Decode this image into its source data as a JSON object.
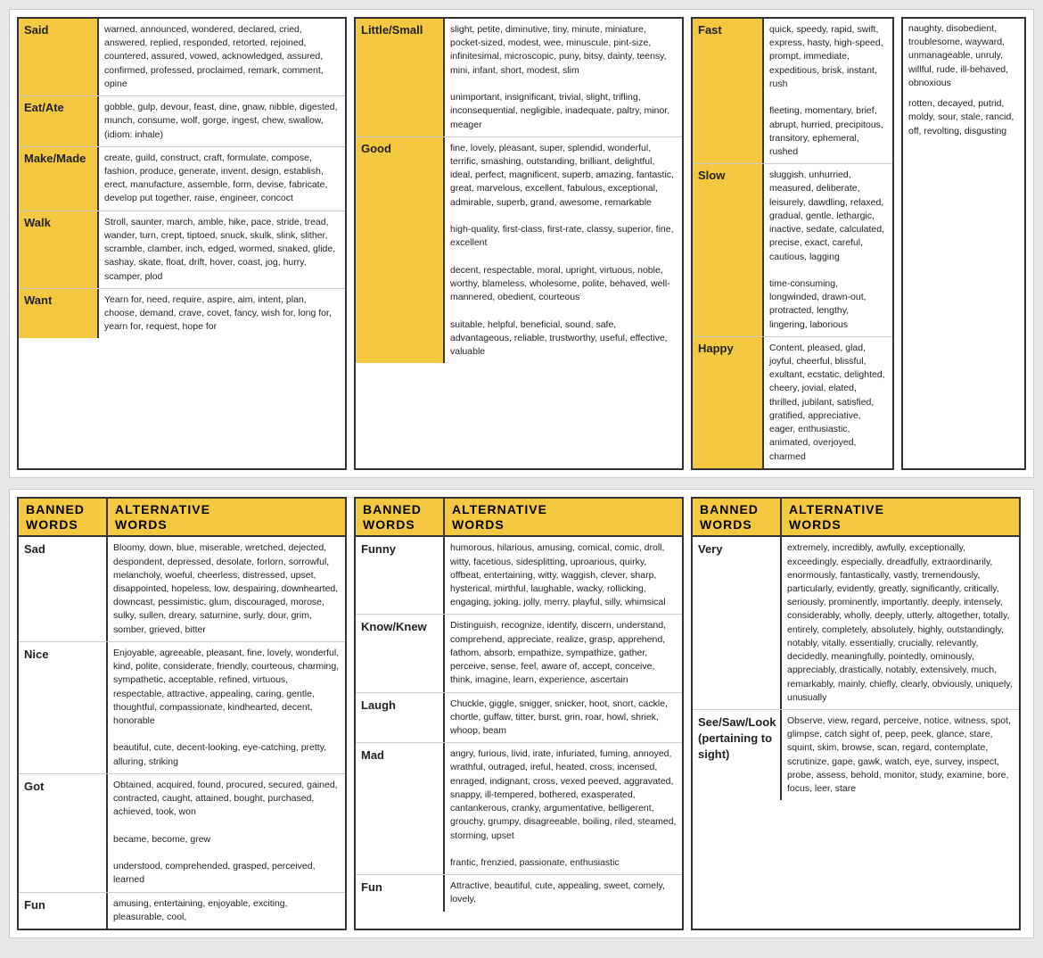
{
  "top_section": {
    "cards": [
      {
        "word": "Said",
        "alts": "warned, announced, wondered, declared, cried, answered, replied, responded, retorted, rejoined, countered, assured, vowed, acknowledged, assured, confirmed, professed, proclaimed, remark, comment, opine"
      },
      {
        "word": "Eat/Ate",
        "alts": "gobble, gulp, devour, feast, dine, gnaw, nibble, digested, munch, consume, wolf, gorge, ingest, chew, swallow, (idiom: inhale)"
      },
      {
        "word": "Make/Made",
        "alts": "create, guild, construct, craft, formulate, compose, fashion, produce, generate, invent, design, establish, erect, manufacture, assemble, form, devise, fabricate, develop put together, raise, engineer, concoct"
      },
      {
        "word": "Walk",
        "alts": "Stroll, saunter, march, amble, hike, pace, stride, tread, wander, turn, crept, tiptoed, snuck, skulk, slink, slither, scramble, clamber, inch, edged, wormed, snaked, glide, sashay, skate, float, drift, hover, coast, jog, hurry, scamper, plod"
      },
      {
        "word": "Want",
        "alts": "Yearn for, need, require, aspire, aim, intent, plan, choose, demand, crave, covet, fancy, wish for, long for, yearn for, request, hope for"
      }
    ]
  },
  "top_middle_cards": [
    {
      "word": "Little/Small",
      "alts_lines": [
        "slight, petite, diminutive, tiny, minute, miniature, pocket-sized, modest, wee, minuscule, pint-size, infinitesimal, microscopic, puny, bitsy, dainty, teensy, mini, infant, short, modest, slim",
        "unimportant, insignificant, trivial, slight, trifling, inconsequential, negligible, inadequate, paltry, minor, meager"
      ]
    },
    {
      "word": "Good",
      "alts_lines": [
        "fine, lovely, pleasant, super, splendid, wonderful, terrific, smashing, outstanding, brilliant, delightful, ideal, perfect, magnificent, superb, amazing, fantastic, great, marvelous, excellent, fabulous, exceptional, admirable, superb, grand, awesome, remarkable",
        "high-quality, first-class, first-rate, classy, superior, fine, excellent",
        "decent, respectable, moral, upright, virtuous, noble, worthy, blameless, wholesome, polite, behaved, well-mannered, obedient, courteous",
        "suitable, helpful, beneficial, sound, safe, advantageous, reliable, trustworthy, useful, effective, valuable"
      ]
    }
  ],
  "top_right_cards": [
    {
      "word": "Fast",
      "alts_lines": [
        "quick, speedy, rapid, swift, express, hasty, high-speed, prompt, immediate, expeditious, brisk, instant, rush",
        "fleeting, momentary, brief, abrupt, hurried, precipitous, transitory, ephemeral, rushed"
      ]
    },
    {
      "word": "Slow",
      "alts_lines": [
        "sluggish, unhurried, measured, deliberate, leisurely, dawdling, relaxed, gradual, gentle, lethargic, inactive, sedate, calculated, precise, exact, careful, cautious, lagging",
        "time-consuming, longwinded, drawn-out, protracted, lengthy, lingering, laborious"
      ]
    },
    {
      "word": "Happy",
      "alts": "Content, pleased, glad, joyful, cheerful, blissful, exultant, ecstatic, delighted, cheery, jovial, elated, thrilled, jubilant, satisfied, gratified, appreciative, eager, enthusiastic, animated, overjoyed, charmed"
    }
  ],
  "top_right2_cards": [
    {
      "label": "naughty",
      "alts": "naughty, disobedient, troublesome, wayward, unmanageable, unruly, willful, rude, ill-behaved, obnoxious"
    },
    {
      "label": "rotten",
      "alts": "rotten, decayed, putrid, moldy, sour, stale, rancid, off, revolting, disgusting"
    }
  ],
  "bottom_section": {
    "groups": [
      {
        "title_banned": "BANNED\nWORDS",
        "title_alt": "ALTERNATIVE\nWORDS",
        "entries": [
          {
            "word": "Sad",
            "alts": "Bloomy, down, blue, miserable, wretched, dejected, despondent, depressed, desolate, forlorn, sorrowful, melancholy, woeful, cheerless, distressed, upset, disappointed, hopeless, low, despairing, downhearted, downcast, pessimistic, glum, discouraged, morose, sulky, sullen, dreary, saturnine, surly, dour, grim, somber, grieved, bitter"
          },
          {
            "word": "Nice",
            "alts": "Enjoyable, agreeable, pleasant, fine, lovely, wonderful, kind, polite, considerate, friendly, courteous, charming, sympathetic, acceptable, refined, virtuous, respectable, attractive, appealing, caring, gentle, thoughtful, compassionate, kindhearted, decent, honorable\n\nbeautiful, cute, decent-looking, eye-catching, pretty, alluring, striking"
          },
          {
            "word": "Got",
            "alts": "Obtained, acquired, found, procured, secured, gained, contracted, caught, attained, bought, purchased, achieved, took, won\n\nbecame, become, grew\n\nunderstood, comprehended, grasped, perceived, learned"
          },
          {
            "word": "Fun",
            "alts": "amusing, entertaining, enjoyable, exciting, pleasurable, cool,"
          }
        ]
      },
      {
        "title_banned": "BANNED\nWORDS",
        "title_alt": "ALTERNATIVE\nWORDS",
        "entries": [
          {
            "word": "Funny",
            "alts": "humorous, hilarious, amusing, comical, comic, droll, witty, facetious, sidesplitting, uproarious, quirky, offbeat, entertaining, witty, waggish, clever, sharp, hysterical, mirthful, laughable, wacky, rollicking, engaging, joking, jolly, merry, playful, silly, whimsical"
          },
          {
            "word": "Know/Knew",
            "alts": "Distinguish, recognize, identify, discern, understand, comprehend, appreciate, realize, grasp, apprehend, fathom, absorb, empathize, sympathize, gather, perceive, sense, feel, aware of, accept, conceive, think, imagine, learn, experience, ascertain"
          },
          {
            "word": "Laugh",
            "alts": "Chuckle, giggle, snigger, snicker, hoot, snort, cackle, chortle, guffaw, titter, burst, grin, roar, howl, shriek, whoop, beam"
          },
          {
            "word": "Mad",
            "alts": "angry, furious, livid, irate, infuriated, fuming, annoyed, wrathful, outraged, ireful, heated, cross, incensed, enraged, indignant, cross, vexed peeved, aggravated, snappy, ill-tempered, bothered, exasperated, cantankerous, cranky, argumentative, belligerent, grouchy, grumpy, disagreeable, boiling, riled, steamed, storming, upset\n\nfrantic, frenzied, passionate, enthusiastic"
          },
          {
            "word": "Fun",
            "alts": "Attractive, beautiful, cute, appealing, sweet, comely, lovely,"
          }
        ]
      },
      {
        "title_banned": "BANNED\nWORDS",
        "title_alt": "ALTERNATIVE\nWORDS",
        "entries": [
          {
            "word": "Very",
            "alts": "extremely, incredibly, awfully, exceptionally, exceedingly, especially, dreadfully, extraordinarily, enormously, fantastically, vastly, tremendously, particularly, evidently, greatly, significantly, critically, seriously, prominently, importantly, deeply, intensely, considerably, wholly, deeply, utterly, altogether, totally, entirely, completely, absolutely, highly, outstandingly, notably, vitally, essentially, crucially, relevantly, decidedly, meaningfully, pointedly, ominously, appreciably, drastically, notably, extensively, much, remarkably, mainly, chiefly, clearly, obviously, uniquely, unusually"
          },
          {
            "word": "See/Saw/Look\n(pertaining to sight)",
            "alts": "Observe, view, regard, perceive, notice, witness, spot, glimpse, catch sight of, peep, peek, glance, stare, squint, skim, browse, scan, regard, contemplate, scrutinize, gape, gawk, watch, eye, survey, inspect, probe, assess, behold, monitor, study, examine, bore, focus, leer, stare"
          }
        ]
      }
    ]
  }
}
